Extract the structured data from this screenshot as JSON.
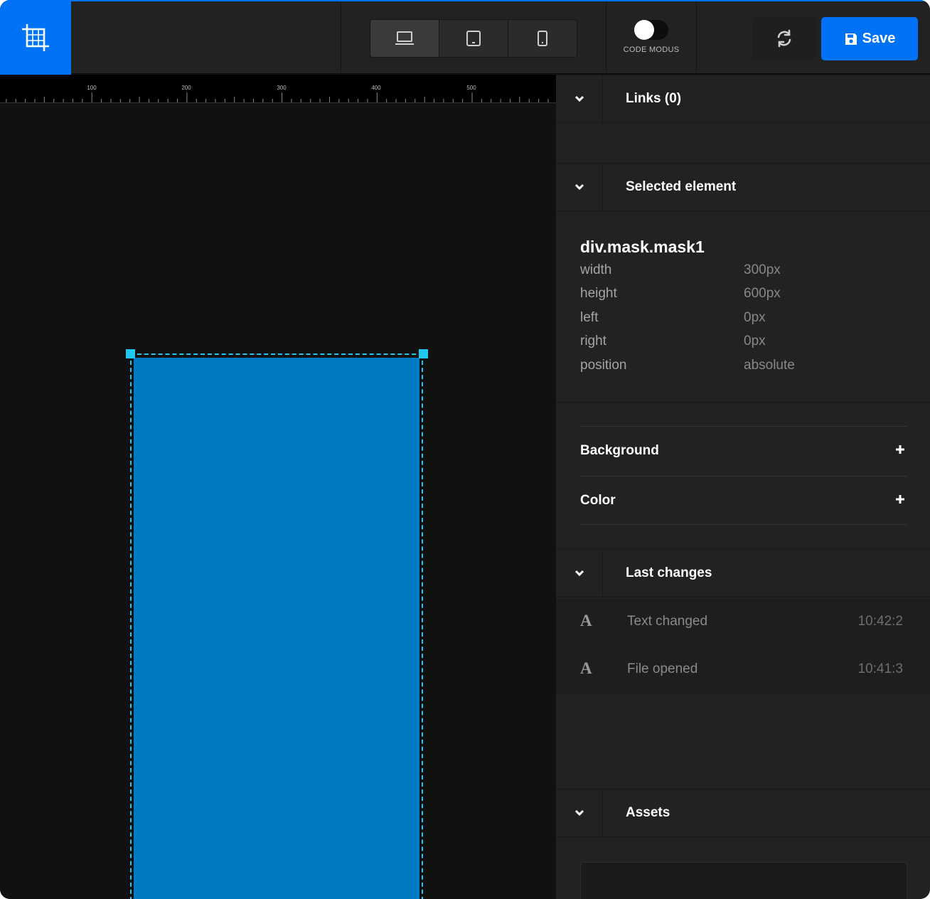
{
  "toolbar": {
    "logo_icon": "crop-grid-icon",
    "devices": [
      {
        "name": "desktop",
        "icon": "laptop-icon",
        "active": true
      },
      {
        "name": "tablet",
        "icon": "tablet-icon",
        "active": false
      },
      {
        "name": "mobile",
        "icon": "phone-icon",
        "active": false
      }
    ],
    "code_modus_label": "CODE MODUS",
    "code_modus_on": false,
    "refresh_icon": "refresh-icon",
    "save_label": "Save",
    "save_icon": "floppy-disk-icon",
    "accent_color": "#0072f5"
  },
  "ruler": {
    "labels": [
      "100",
      "200",
      "300",
      "400",
      "500"
    ]
  },
  "canvas": {
    "mask_color": "#0079c4",
    "selection_color": "#1ec8f0"
  },
  "panel": {
    "links": {
      "title": "Links (0)"
    },
    "selected": {
      "title": "Selected element",
      "name": "div.mask.mask1",
      "props": [
        {
          "key": "width",
          "value": "300px"
        },
        {
          "key": "height",
          "value": "600px"
        },
        {
          "key": "left",
          "value": "0px"
        },
        {
          "key": "right",
          "value": "0px"
        },
        {
          "key": "position",
          "value": "absolute"
        }
      ],
      "background_label": "Background",
      "color_label": "Color"
    },
    "last_changes": {
      "title": "Last changes",
      "items": [
        {
          "icon": "A",
          "text": "Text changed",
          "time": "10:42:2"
        },
        {
          "icon": "A",
          "text": "File opened",
          "time": "10:41:3"
        }
      ]
    },
    "assets": {
      "title": "Assets"
    }
  }
}
